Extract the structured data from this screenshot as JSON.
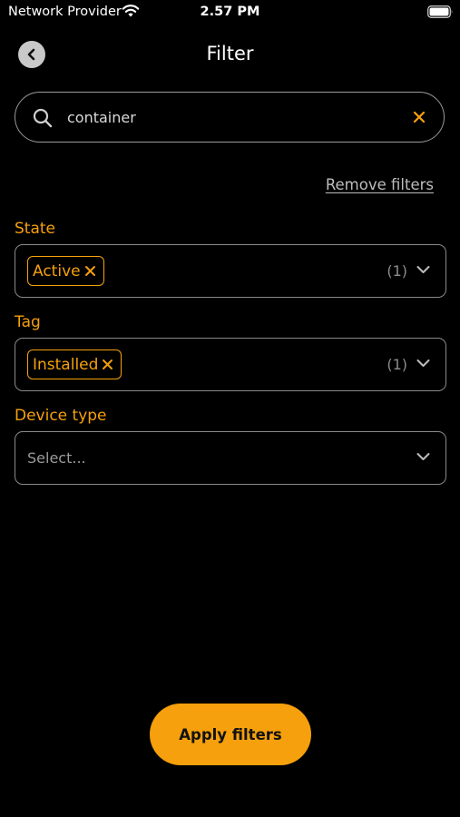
{
  "status_bar": {
    "carrier": "Network Provider",
    "time": "2.57 PM",
    "wifi_icon": "wifi-icon",
    "battery_icon": "battery-icon"
  },
  "header": {
    "title": "Filter",
    "back_icon": "chevron-left-icon"
  },
  "search": {
    "value": "container",
    "placeholder": "",
    "icon": "search-icon",
    "clear_icon": "close-icon"
  },
  "remove_filters_label": "Remove filters",
  "filters": {
    "state": {
      "label": "State",
      "chip": "Active",
      "count": "(1)"
    },
    "tag": {
      "label": "Tag",
      "chip": "Installed",
      "count": "(1)"
    },
    "device_type": {
      "label": "Device type",
      "placeholder": "Select..."
    }
  },
  "apply_button_label": "Apply filters",
  "colors": {
    "accent": "#f5a00c",
    "background": "#000000",
    "text": "#ffffff",
    "muted": "#8d8d8d"
  }
}
